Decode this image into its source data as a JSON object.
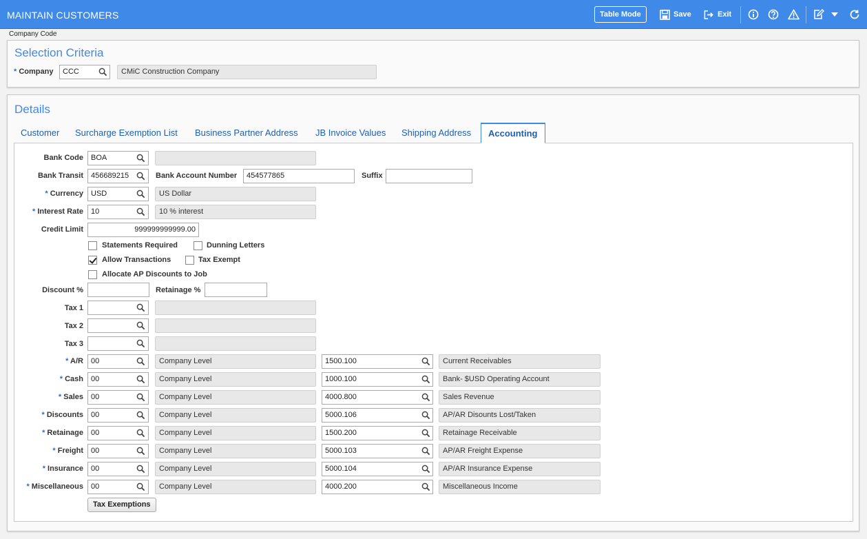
{
  "header": {
    "title": "MAINTAIN CUSTOMERS",
    "table_mode": "Table Mode",
    "save": "Save",
    "exit": "Exit",
    "bg_color": "#3f8ae8"
  },
  "breadcrumb": "Company Code",
  "selection": {
    "title": "Selection Criteria",
    "company_label": "Company",
    "company_code": "CCC",
    "company_name": "CMiC Construction Company"
  },
  "details": {
    "title": "Details",
    "tabs": [
      "Customer",
      "Surcharge Exemption List",
      "Business Partner Address",
      "JB Invoice Values",
      "Shipping Address",
      "Accounting"
    ],
    "active_tab": "Accounting"
  },
  "accounting": {
    "bank_code": {
      "label": "Bank Code",
      "value": "BOA",
      "desc": ""
    },
    "bank_transit": {
      "label": "Bank Transit",
      "value": "456689215"
    },
    "bank_account_number": {
      "label": "Bank Account Number",
      "value": "454577865"
    },
    "suffix": {
      "label": "Suffix",
      "value": ""
    },
    "currency": {
      "label": "Currency",
      "value": "USD",
      "desc": "US Dollar"
    },
    "interest_rate": {
      "label": "Interest Rate",
      "value": "10",
      "desc": "10 % interest"
    },
    "credit_limit": {
      "label": "Credit Limit",
      "value": "999999999999.00"
    },
    "checkboxes": {
      "statements_required": {
        "label": "Statements Required",
        "checked": false
      },
      "dunning_letters": {
        "label": "Dunning Letters",
        "checked": false
      },
      "allow_transactions": {
        "label": "Allow Transactions",
        "checked": true
      },
      "tax_exempt": {
        "label": "Tax Exempt",
        "checked": false
      },
      "allocate_ap": {
        "label": "Allocate AP Discounts to Job",
        "checked": false
      }
    },
    "discount": {
      "label": "Discount %",
      "value": ""
    },
    "retainage_pct": {
      "label": "Retainage %",
      "value": ""
    },
    "taxes": [
      {
        "label": "Tax 1",
        "value": "",
        "desc": ""
      },
      {
        "label": "Tax 2",
        "value": "",
        "desc": ""
      },
      {
        "label": "Tax 3",
        "value": "",
        "desc": ""
      }
    ],
    "gl_rows": [
      {
        "label": "A/R",
        "dept": "00",
        "dept_desc": "Company Level",
        "account": "1500.100",
        "account_desc": "Current Receivables"
      },
      {
        "label": "Cash",
        "dept": "00",
        "dept_desc": "Company Level",
        "account": "1000.100",
        "account_desc": "Bank- $USD Operating Account"
      },
      {
        "label": "Sales",
        "dept": "00",
        "dept_desc": "Company Level",
        "account": "4000.800",
        "account_desc": "Sales Revenue"
      },
      {
        "label": "Discounts",
        "dept": "00",
        "dept_desc": "Company Level",
        "account": "5000.106",
        "account_desc": "AP/AR Disounts Lost/Taken"
      },
      {
        "label": "Retainage",
        "dept": "00",
        "dept_desc": "Company Level",
        "account": "1500.200",
        "account_desc": "Retainage Receivable"
      },
      {
        "label": "Freight",
        "dept": "00",
        "dept_desc": "Company Level",
        "account": "5000.103",
        "account_desc": "AP/AR Freight Expense"
      },
      {
        "label": "Insurance",
        "dept": "00",
        "dept_desc": "Company Level",
        "account": "5000.104",
        "account_desc": "AP/AR Insurance Expense"
      },
      {
        "label": "Miscellaneous",
        "dept": "00",
        "dept_desc": "Company Level",
        "account": "4000.200",
        "account_desc": "Miscellaneous Income"
      }
    ],
    "tax_exemptions_button": "Tax Exemptions"
  }
}
